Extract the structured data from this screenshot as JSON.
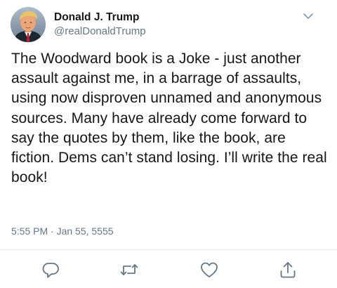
{
  "tweet": {
    "author": {
      "display_name": "Donald J. Trump",
      "handle": "@realDonaldTrump",
      "avatar_icon": "profile-photo"
    },
    "text": "The Woodward book is a Joke - just another assault against me, in a barrage of assaults, using now disproven unnamed and anonymous sources. Many have already come forward to say the quotes by them, like the book, are fiction. Dems can’t stand losing. I’ll write the real book!",
    "timestamp": "5:55 PM · Jan 55, 5555",
    "menu_icon": "chevron-down-icon",
    "actions": [
      {
        "name": "reply",
        "icon": "reply-icon"
      },
      {
        "name": "retweet",
        "icon": "retweet-icon"
      },
      {
        "name": "like",
        "icon": "heart-icon"
      },
      {
        "name": "share",
        "icon": "share-icon"
      }
    ],
    "colors": {
      "text": "#14171a",
      "secondary": "#657786",
      "divider": "#e6ecf0"
    }
  }
}
